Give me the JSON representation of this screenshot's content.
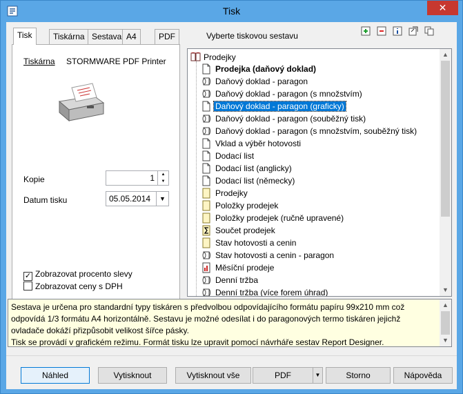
{
  "window": {
    "title": "Tisk",
    "close_label": "✕"
  },
  "tabs": [
    {
      "label": "Tisk"
    },
    {
      "label": "Tiskárna"
    },
    {
      "label": "Sestava"
    },
    {
      "label": "A4"
    },
    {
      "label": "PDF"
    }
  ],
  "report_hint": "Vyberte tiskovou sestavu",
  "toolbar_icons": [
    "add-icon",
    "remove-icon",
    "info-icon",
    "refresh-icon",
    "copy-icon"
  ],
  "printer": {
    "label": "Tiskárna",
    "name": "STORMWARE PDF Printer"
  },
  "copies": {
    "label": "Kopie",
    "value": "1"
  },
  "print_date": {
    "label": "Datum tisku",
    "value": "05.05.2014"
  },
  "options": [
    {
      "label": "Zobrazovat procento slevy",
      "checked": true
    },
    {
      "label": "Zobrazovat ceny s DPH",
      "checked": false
    }
  ],
  "tree": {
    "root": "Prodejky",
    "items": [
      {
        "label": "Prodejka (daňový doklad)",
        "icon": "page-icon",
        "bold": true,
        "selected": false
      },
      {
        "label": "Daňový doklad - paragon",
        "icon": "roll-icon",
        "bold": false,
        "selected": false
      },
      {
        "label": "Daňový doklad - paragon (s množstvím)",
        "icon": "roll-icon",
        "bold": false,
        "selected": false
      },
      {
        "label": "Daňový doklad - paragon (graficky)",
        "icon": "page-icon",
        "bold": false,
        "selected": true
      },
      {
        "label": "Daňový doklad - paragon (souběžný tisk)",
        "icon": "roll-icon",
        "bold": false,
        "selected": false
      },
      {
        "label": "Daňový doklad - paragon (s množstvím, souběžný tisk)",
        "icon": "roll-icon",
        "bold": false,
        "selected": false
      },
      {
        "label": "Vklad a výběr hotovosti",
        "icon": "page-icon",
        "bold": false,
        "selected": false
      },
      {
        "label": "Dodací list",
        "icon": "page-icon",
        "bold": false,
        "selected": false
      },
      {
        "label": "Dodací list (anglicky)",
        "icon": "page-icon",
        "bold": false,
        "selected": false
      },
      {
        "label": "Dodací list (německy)",
        "icon": "page-icon",
        "bold": false,
        "selected": false
      },
      {
        "label": "Prodejky",
        "icon": "list-page-icon",
        "bold": false,
        "selected": false
      },
      {
        "label": "Položky prodejek",
        "icon": "list-page-icon",
        "bold": false,
        "selected": false
      },
      {
        "label": "Položky prodejek (ručně upravené)",
        "icon": "list-page-icon",
        "bold": false,
        "selected": false
      },
      {
        "label": "Součet prodejek",
        "icon": "sum-icon",
        "bold": false,
        "selected": false
      },
      {
        "label": "Stav hotovosti a cenin",
        "icon": "list-page-icon",
        "bold": false,
        "selected": false
      },
      {
        "label": "Stav hotovosti a cenin - paragon",
        "icon": "roll-icon",
        "bold": false,
        "selected": false
      },
      {
        "label": "Měsíční prodeje",
        "icon": "chart-icon",
        "bold": false,
        "selected": false
      },
      {
        "label": "Denní tržba",
        "icon": "roll-icon",
        "bold": false,
        "selected": false
      },
      {
        "label": "Denní tržba (více forem úhrad)",
        "icon": "roll-icon",
        "bold": false,
        "selected": false
      }
    ]
  },
  "description": {
    "lines": [
      "Sestava je určena pro standardní typy tiskáren s předvolbou odpovídajícího formátu papíru  99x210 mm což",
      "odpovídá 1/3 formátu A4 horizontálně. Sestavu je možné odesílat i do paragonových termo tiskáren jejichž",
      "ovladače dokáží přizpůsobit velikost šířce pásky.",
      "Tisk se provádí v grafickém režimu. Formát tisku lze upravit pomocí návrháře sestav Report Designer."
    ]
  },
  "buttons": {
    "preview": "Náhled",
    "print": "Vytisknout",
    "print_all": "Vytisknout vše",
    "pdf": "PDF",
    "cancel": "Storno",
    "help": "Nápověda"
  },
  "colors": {
    "title_bar": "#5aa7e6",
    "close_button": "#c7382f",
    "selection": "#0078d7",
    "description_bg": "#ffffe1"
  }
}
